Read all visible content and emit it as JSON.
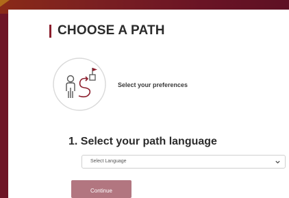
{
  "page": {
    "title": "CHOOSE A PATH"
  },
  "preferences": {
    "icon": "person-path-flag-icon",
    "text": "Select your preferences"
  },
  "language_section": {
    "heading": "1. Select your path language",
    "select": {
      "selected_value": "Select Language",
      "icon": "chevron-down-icon"
    }
  },
  "actions": {
    "continue_label": "Continue"
  },
  "colors": {
    "background": "#6e1526",
    "accent": "#8b1d2c",
    "button": "#b27680"
  }
}
